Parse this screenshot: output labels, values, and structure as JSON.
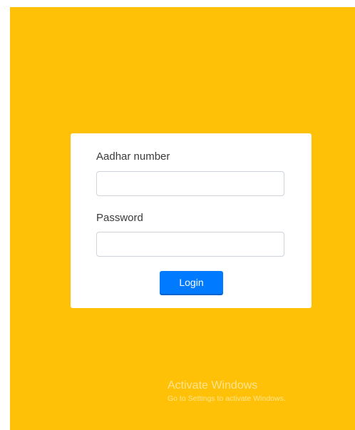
{
  "login_form": {
    "aadhar_label": "Aadhar number",
    "aadhar_value": "",
    "password_label": "Password",
    "password_value": "",
    "login_button_label": "Login"
  },
  "watermark": {
    "title": "Activate Windows",
    "subtitle": "Go to Settings to activate Windows."
  },
  "colors": {
    "background": "#ffc107",
    "card": "#ffffff",
    "button": "#007bff"
  }
}
